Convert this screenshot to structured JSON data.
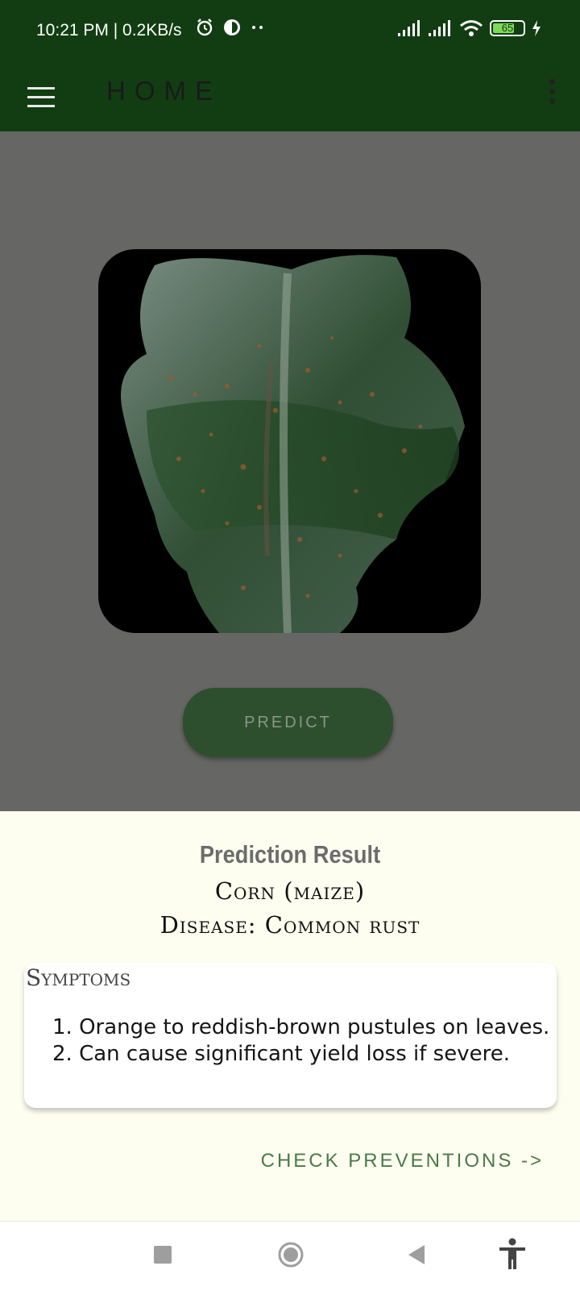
{
  "status_bar": {
    "time_speed": "10:21 PM | 0.2KB/s",
    "battery": "65",
    "icons": [
      "alarm-icon",
      "data-saver-icon",
      "dots-icon",
      "signal-icon",
      "signal-icon",
      "wifi-icon",
      "battery-icon",
      "charging-icon"
    ]
  },
  "app_bar": {
    "title": "HOME",
    "menu_icon": "hamburger-icon",
    "overflow_icon": "more-vert-icon"
  },
  "predict_button": "PREDICT",
  "result": {
    "title": "Prediction Result",
    "crop": "Corn (maize)",
    "disease": "Disease: Common rust",
    "symptoms_heading": "Symptoms",
    "symptoms": [
      "1. Orange to reddish-brown pustules on leaves.",
      "2. Can cause significant yield loss if severe."
    ],
    "check_preventions": "CHECK PREVENTIONS ->"
  },
  "nav_bar": {
    "icons": [
      "recents-icon",
      "home-icon",
      "back-icon",
      "accessibility-icon"
    ]
  },
  "colors": {
    "app_bar": "#123d12",
    "overlay": "#666764",
    "sheet": "#fdfef0",
    "button": "#2d4f2d",
    "link": "#4a7a4a"
  }
}
